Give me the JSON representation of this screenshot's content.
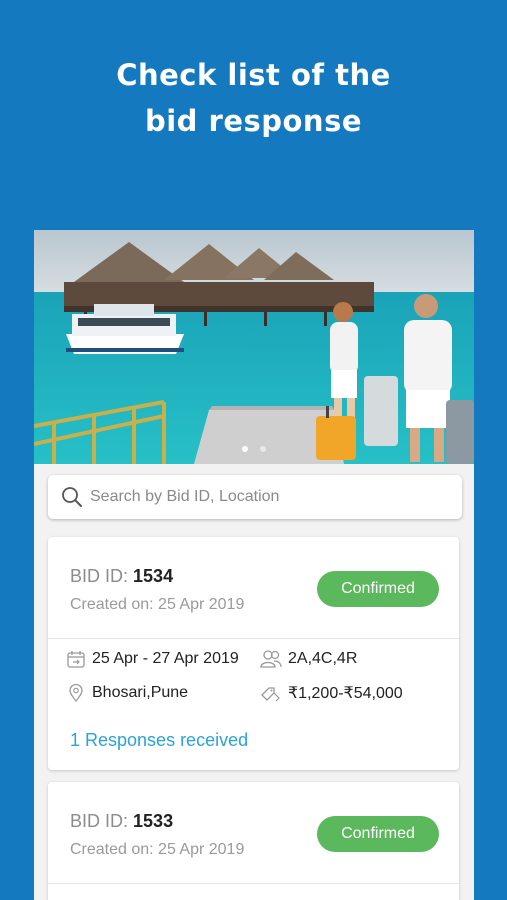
{
  "headline": {
    "line1": "Check list of the",
    "line2": "bid response"
  },
  "carousel": {
    "slides": 2,
    "active_index": 0
  },
  "search": {
    "placeholder": "Search by Bid ID, Location",
    "value": ""
  },
  "bids": [
    {
      "label": "BID ID:",
      "id": "1534",
      "created": "Created on: 25 Apr 2019",
      "status": "Confirmed",
      "dates": "25 Apr - 27 Apr 2019",
      "guests": "2A,4C,4R",
      "location": "Bhosari,Pune",
      "budget": "₹1,200-₹54,000",
      "responses": "1 Responses received"
    },
    {
      "label": "BID ID:",
      "id": "1533",
      "created": "Created on: 25 Apr 2019",
      "status": "Confirmed"
    }
  ],
  "colors": {
    "background": "#1479be",
    "status_confirmed": "#5cb85c",
    "link": "#2aa3d8"
  }
}
